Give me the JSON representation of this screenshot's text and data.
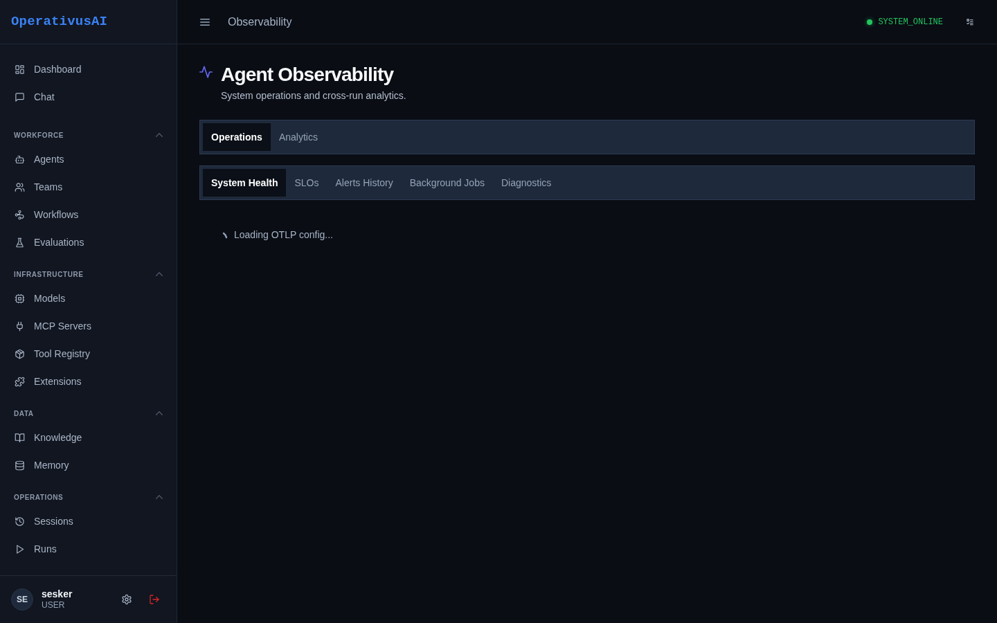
{
  "sidebar": {
    "logo": "OperativusAI",
    "sections": [
      {
        "items": [
          {
            "label": "Dashboard",
            "selected": false
          },
          {
            "label": "Chat",
            "selected": false
          }
        ]
      },
      {
        "title": "WORKFORCE",
        "expanded": true,
        "items": [
          {
            "label": "Agents",
            "selected": false
          },
          {
            "label": "Teams",
            "selected": false
          },
          {
            "label": "Workflows",
            "selected": false
          },
          {
            "label": "Evaluations",
            "selected": false
          }
        ]
      },
      {
        "title": "INFRASTRUCTURE",
        "expanded": true,
        "items": [
          {
            "label": "Models",
            "selected": false
          },
          {
            "label": "MCP Servers",
            "selected": false
          },
          {
            "label": "Tool Registry",
            "selected": false
          },
          {
            "label": "Extensions",
            "selected": false
          }
        ]
      },
      {
        "title": "DATA",
        "expanded": true,
        "items": [
          {
            "label": "Knowledge",
            "selected": false
          },
          {
            "label": "Memory",
            "selected": false
          }
        ]
      },
      {
        "title": "OPERATIONS",
        "expanded": true,
        "items": [
          {
            "label": "Sessions",
            "selected": false
          },
          {
            "label": "Runs",
            "selected": false
          }
        ]
      }
    ],
    "user": {
      "initials": "SE",
      "name": "sesker",
      "role": "USER"
    }
  },
  "header": {
    "title": "Observability",
    "status": "SYSTEM_ONLINE"
  },
  "page": {
    "title": "Agent Observability",
    "subtitle": "System operations and cross-run analytics."
  },
  "tabs": [
    {
      "label": "Operations",
      "selected": true
    },
    {
      "label": "Analytics",
      "selected": false
    }
  ],
  "subtabs": [
    {
      "label": "System Health",
      "selected": true
    },
    {
      "label": "SLOs",
      "selected": false
    },
    {
      "label": "Alerts History",
      "selected": false
    },
    {
      "label": "Background Jobs",
      "selected": false
    },
    {
      "label": "Diagnostics",
      "selected": false
    }
  ],
  "loading": {
    "text": "Loading OTLP config..."
  }
}
